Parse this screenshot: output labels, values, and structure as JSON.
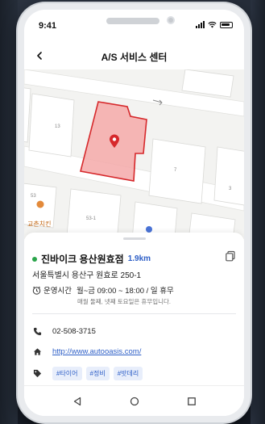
{
  "status_bar": {
    "time": "9:41",
    "icons": [
      "signal-icon",
      "wifi-icon",
      "battery-icon"
    ]
  },
  "appbar": {
    "title": "A/S 서비스 센터",
    "back_icon": "chevron-left-icon"
  },
  "map": {
    "labels": {
      "building_13": "13",
      "building_7": "7",
      "building_3": "3",
      "building_53": "53",
      "building_53_1": "53-1",
      "poi_chicken": "교촌치킨"
    },
    "marker_icon": "map-pin-icon",
    "highlight_color": "#f3a3a3",
    "highlight_border": "#d6282b"
  },
  "place": {
    "name": "진바이크 용산원효점",
    "distance": "1.9km",
    "status_color": "#2aa44a",
    "address": "서울특별시 용산구 원효로 250-1",
    "hours_label": "운영시간",
    "hours": "월~금 09:00 ~ 18:00 / 일 휴무",
    "hours_note": "매월 둘째, 넷째 토요일은 휴무입니다.",
    "phone": "02-508-3715",
    "website": "http://www.autooasis.com/",
    "tags": [
      "#타이어",
      "#정비",
      "#밧데리"
    ]
  },
  "colors": {
    "accent": "#2e5fc7",
    "tag_bg": "#e8eefb"
  },
  "navbar": {
    "icons": [
      "back-triangle-icon",
      "home-circle-icon",
      "recents-square-icon"
    ]
  }
}
